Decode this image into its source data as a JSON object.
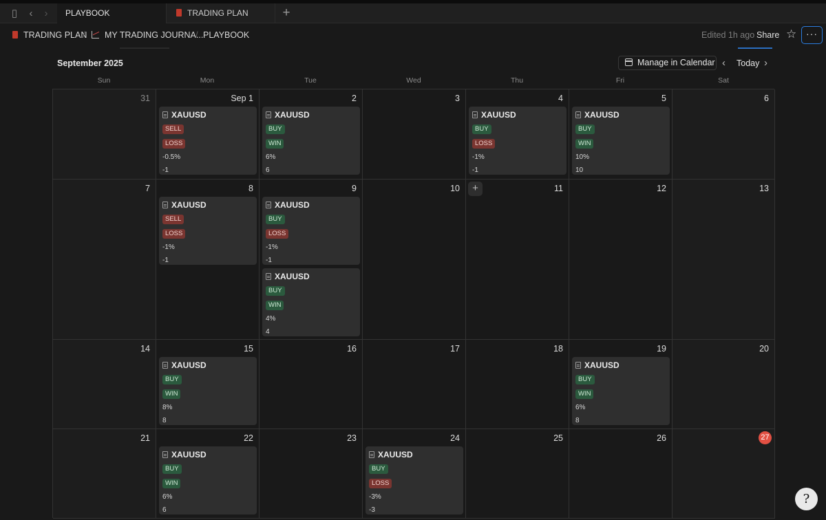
{
  "tabs": [
    {
      "label": "PLAYBOOK",
      "active": true,
      "has_icon": false
    },
    {
      "label": "TRADING PLAN",
      "active": false,
      "has_icon": true
    }
  ],
  "breadcrumb": {
    "items": [
      {
        "label": "TRADING PLAN",
        "icon": "book-icon"
      },
      {
        "label": "MY TRADING JOURNA...",
        "icon": "chart-icon"
      },
      {
        "label": "PLAYBOOK",
        "icon": ""
      }
    ],
    "separator": "/"
  },
  "header_right": {
    "edited": "Edited 1h ago",
    "share": "Share",
    "more": "···"
  },
  "calendar": {
    "month": "September 2025",
    "manage_label": "Manage in Calendar",
    "today_label": "Today",
    "weekdays": [
      "Sun",
      "Mon",
      "Tue",
      "Wed",
      "Thu",
      "Fri",
      "Sat"
    ],
    "weeks": [
      [
        {
          "day": "31",
          "muted": true,
          "entries": []
        },
        {
          "day": "Sep 1",
          "entries": [
            {
              "symbol": "XAUUSD",
              "side": "SELL",
              "result": "LOSS",
              "pct": "-0.5%",
              "r": "-1"
            }
          ]
        },
        {
          "day": "2",
          "entries": [
            {
              "symbol": "XAUUSD",
              "side": "BUY",
              "result": "WIN",
              "pct": "6%",
              "r": "6"
            }
          ]
        },
        {
          "day": "3",
          "entries": []
        },
        {
          "day": "4",
          "entries": [
            {
              "symbol": "XAUUSD",
              "side": "BUY",
              "result": "LOSS",
              "pct": "-1%",
              "r": "-1"
            }
          ]
        },
        {
          "day": "5",
          "entries": [
            {
              "symbol": "XAUUSD",
              "side": "BUY",
              "result": "WIN",
              "pct": "10%",
              "r": "10"
            }
          ]
        },
        {
          "day": "6",
          "entries": []
        }
      ],
      [
        {
          "day": "7",
          "entries": []
        },
        {
          "day": "8",
          "entries": [
            {
              "symbol": "XAUUSD",
              "side": "SELL",
              "result": "LOSS",
              "pct": "-1%",
              "r": "-1"
            }
          ]
        },
        {
          "day": "9",
          "entries": [
            {
              "symbol": "XAUUSD",
              "side": "BUY",
              "result": "LOSS",
              "pct": "-1%",
              "r": "-1"
            },
            {
              "symbol": "XAUUSD",
              "side": "BUY",
              "result": "WIN",
              "pct": "4%",
              "r": "4"
            }
          ]
        },
        {
          "day": "10",
          "entries": []
        },
        {
          "day": "11",
          "add_button": true,
          "entries": []
        },
        {
          "day": "12",
          "entries": []
        },
        {
          "day": "13",
          "entries": []
        }
      ],
      [
        {
          "day": "14",
          "entries": []
        },
        {
          "day": "15",
          "entries": [
            {
              "symbol": "XAUUSD",
              "side": "BUY",
              "result": "WIN",
              "pct": "8%",
              "r": "8"
            }
          ]
        },
        {
          "day": "16",
          "entries": []
        },
        {
          "day": "17",
          "entries": []
        },
        {
          "day": "18",
          "entries": []
        },
        {
          "day": "19",
          "entries": [
            {
              "symbol": "XAUUSD",
              "side": "BUY",
              "result": "WIN",
              "pct": "6%",
              "r": "8"
            }
          ]
        },
        {
          "day": "20",
          "entries": []
        }
      ],
      [
        {
          "day": "21",
          "entries": []
        },
        {
          "day": "22",
          "entries": [
            {
              "symbol": "XAUUSD",
              "side": "BUY",
              "result": "WIN",
              "pct": "6%",
              "r": "6"
            }
          ]
        },
        {
          "day": "23",
          "entries": []
        },
        {
          "day": "24",
          "entries": [
            {
              "symbol": "XAUUSD",
              "side": "BUY",
              "result": "LOSS",
              "pct": "-3%",
              "r": "-3"
            }
          ]
        },
        {
          "day": "25",
          "entries": []
        },
        {
          "day": "26",
          "entries": []
        },
        {
          "day": "27",
          "today": true,
          "entries": []
        }
      ]
    ]
  },
  "colors": {
    "win_tag": "#2b5a3e",
    "loss_tag": "#7a3530",
    "buy_tag": "#2b5a3e",
    "sell_tag": "#7a3530",
    "today_badge": "#e25043",
    "focus_ring": "#2b7de0"
  },
  "help_glyph": "?"
}
